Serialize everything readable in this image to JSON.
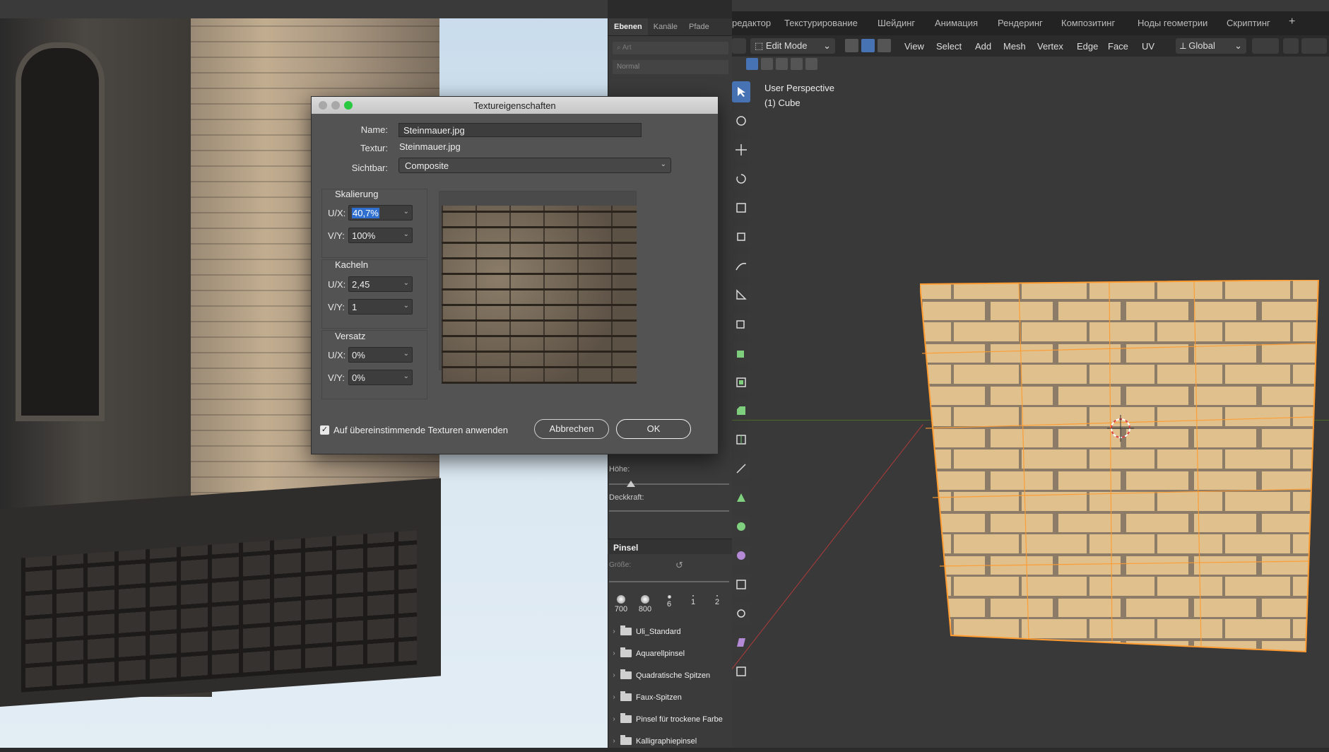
{
  "photoshop": {
    "panel": {
      "tabs": [
        "Ebenen",
        "Kanäle",
        "Pfade"
      ],
      "search_placeholder": "Art",
      "blend_mode": "Normal",
      "sliders": {
        "hoehe": "Höhe:",
        "deckkraft": "Deckkraft:"
      },
      "brush_section": "Pinsel",
      "size_label": "Größe:",
      "brush_presets": [
        "700",
        "800",
        "6",
        "1",
        "2"
      ],
      "brush_folders": [
        "Uli_Standard",
        "Aquarellpinsel",
        "Quadratische Spitzen",
        "Faux-Spitzen",
        "Pinsel für trockene Farbe",
        "Kalligraphiepinsel"
      ]
    },
    "dialog": {
      "title": "Textureigenschaften",
      "name_label": "Name:",
      "name_value": "Steinmauer.jpg",
      "texture_label": "Textur:",
      "texture_value": "Steinmauer.jpg",
      "visible_label": "Sichtbar:",
      "visible_value": "Composite",
      "scaling": {
        "title": "Skalierung",
        "ux_label": "U/X:",
        "ux": "40,7%",
        "vy_label": "V/Y:",
        "vy": "100%"
      },
      "tiling": {
        "title": "Kacheln",
        "ux_label": "U/X:",
        "ux": "2,45",
        "vy_label": "V/Y:",
        "vy": "1"
      },
      "offset": {
        "title": "Versatz",
        "ux_label": "U/X:",
        "ux": "0%",
        "vy_label": "V/Y:",
        "vy": "0%"
      },
      "apply_matching_label": "Auf übereinstimmende Texturen anwenden",
      "apply_matching_checked": true,
      "cancel_label": "Abbrechen",
      "ok_label": "OK"
    }
  },
  "blender": {
    "workspaces": [
      "редактор",
      "Текстурирование",
      "Шейдинг",
      "Анимация",
      "Рендеринг",
      "Композитинг",
      "Ноды геометрии",
      "Скриптинг",
      "+"
    ],
    "mode": "Edit Mode",
    "menus": [
      "View",
      "Select",
      "Add",
      "Mesh",
      "Vertex",
      "Edge",
      "Face",
      "UV"
    ],
    "transform_orientation": "Global",
    "viewport_label": "User Perspective",
    "object_label": "(1) Cube",
    "accent_color": "#4772b3",
    "selection_color": "#ff9b30"
  }
}
